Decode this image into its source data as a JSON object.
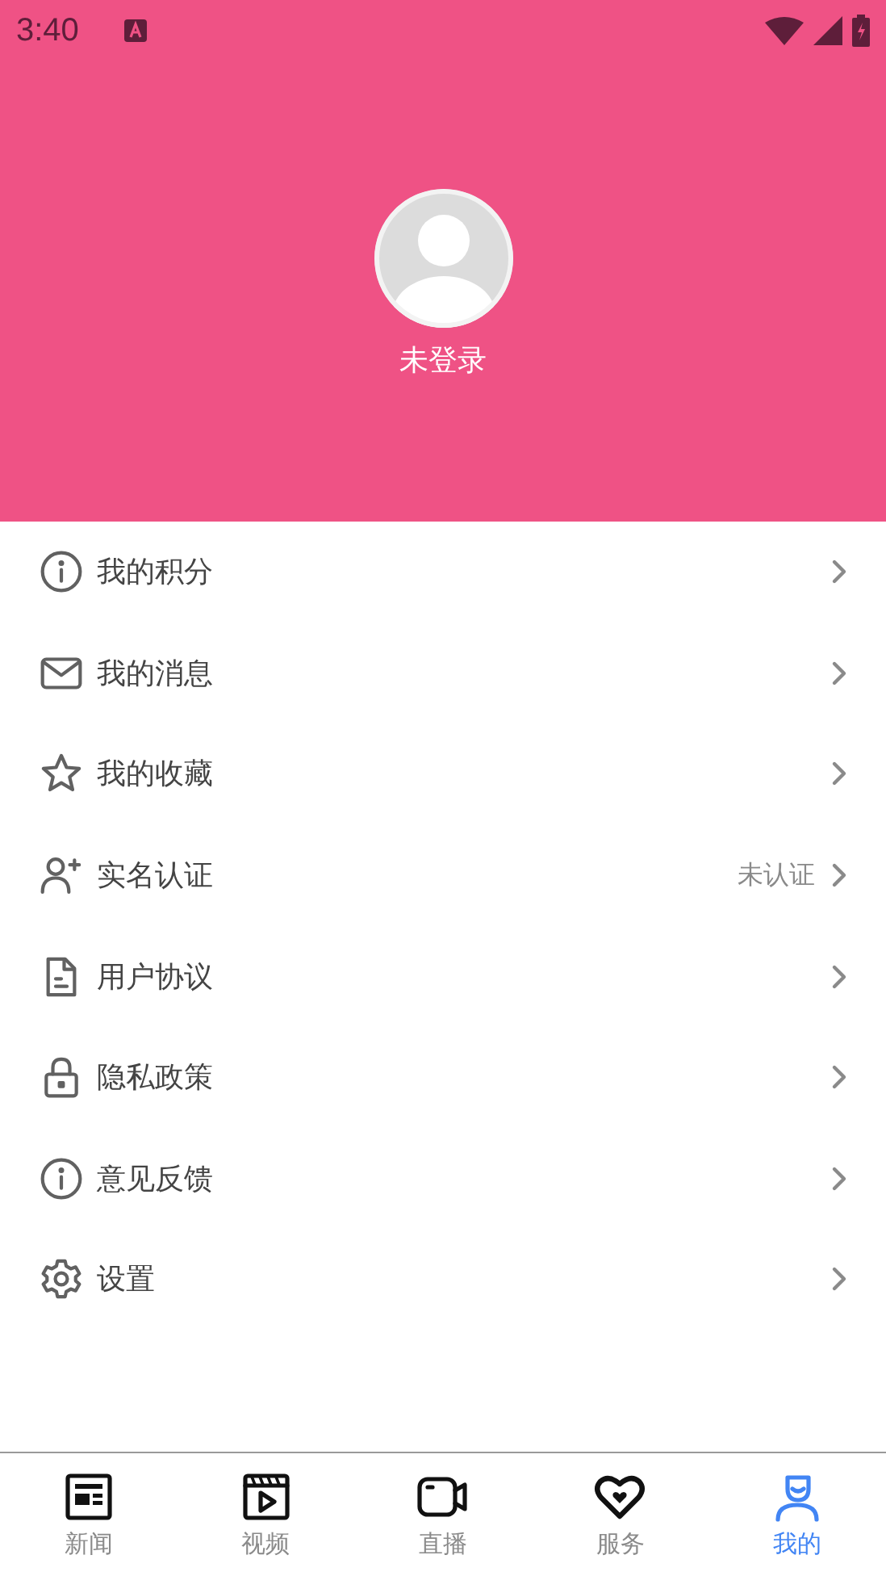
{
  "status_bar": {
    "time": "3:40"
  },
  "profile": {
    "name": "未登录"
  },
  "menu": [
    {
      "label": "我的积分",
      "kind": "info"
    },
    {
      "label": "我的消息",
      "kind": "mail"
    },
    {
      "label": "我的收藏",
      "kind": "star"
    },
    {
      "label": "实名认证",
      "kind": "person-add",
      "value": "未认证"
    },
    {
      "label": "用户协议",
      "kind": "document"
    },
    {
      "label": "隐私政策",
      "kind": "lock"
    },
    {
      "label": "意见反馈",
      "kind": "info"
    },
    {
      "label": "设置",
      "kind": "settings"
    }
  ],
  "tabs": [
    {
      "label": "新闻",
      "kind": "news",
      "selected": false
    },
    {
      "label": "视频",
      "kind": "video",
      "selected": false
    },
    {
      "label": "直播",
      "kind": "camera",
      "selected": false
    },
    {
      "label": "服务",
      "kind": "heart",
      "selected": false
    },
    {
      "label": "我的",
      "kind": "person",
      "selected": true
    }
  ]
}
